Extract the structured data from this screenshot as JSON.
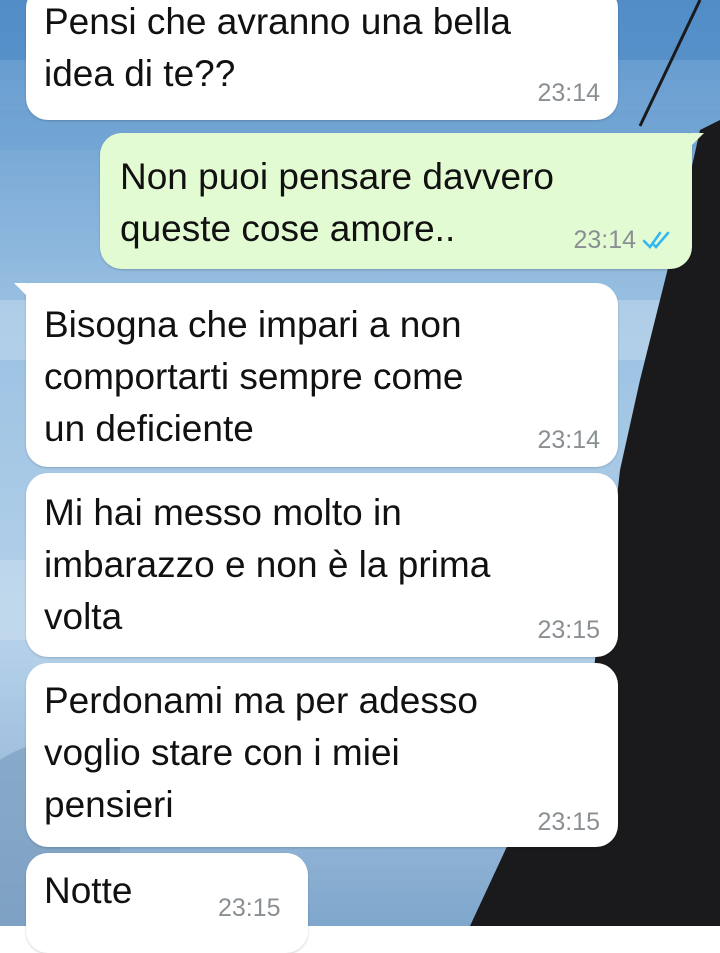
{
  "colors": {
    "incoming_bubble": "#ffffff",
    "outgoing_bubble": "#e3fbd3",
    "timestamp": "#8a8f93",
    "read_ticks": "#34b7f1",
    "wallpaper_sky": "#8fb8dc",
    "wallpaper_dark": "#1a1a1d"
  },
  "messages": [
    {
      "direction": "incoming",
      "text": "Pensi che avranno una bella\nidea di te??",
      "time": "23:14"
    },
    {
      "direction": "outgoing",
      "text": "Non puoi pensare davvero\nqueste cose amore..",
      "time": "23:14",
      "status_icon": "double-check-read-icon"
    },
    {
      "direction": "incoming",
      "text": "Bisogna che impari a non\ncomportarti sempre come\nun deficiente",
      "time": "23:14"
    },
    {
      "direction": "incoming",
      "text": "Mi hai messo molto in\nimbarazzo e non è la prima\nvolta",
      "time": "23:15"
    },
    {
      "direction": "incoming",
      "text": "Perdonami ma per adesso\nvoglio stare con i miei\npensieri",
      "time": "23:15"
    },
    {
      "direction": "incoming",
      "text": "Notte",
      "time": "23:15"
    }
  ]
}
